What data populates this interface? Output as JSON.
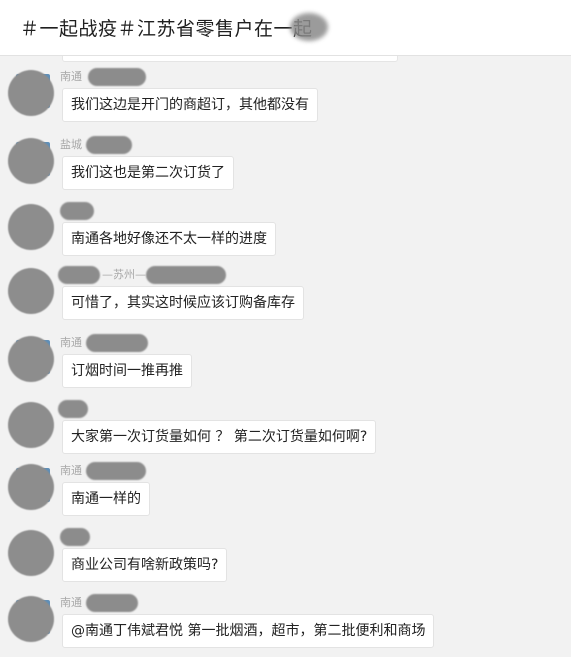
{
  "header": {
    "title": "＃一起战疫＃江苏省零售户在一起"
  },
  "messages": [
    {
      "sender": "南通",
      "text": "我们这边是开门的商超订，其他都没有"
    },
    {
      "sender": "盐城",
      "text": "我们这也是第二次订货了"
    },
    {
      "sender": "",
      "text": "南通各地好像还不太一样的进度"
    },
    {
      "sender": "—苏州—",
      "text": "可惜了，其实这时候应该订购备库存"
    },
    {
      "sender": "南通",
      "text": "订烟时间一推再推"
    },
    {
      "sender": "",
      "text": "大家第一次订货量如何 ？ 第二次订货量如何啊?"
    },
    {
      "sender": "南通",
      "text": "南通一样的"
    },
    {
      "sender": "",
      "text": "商业公司有啥新政策吗?"
    },
    {
      "sender": "南通",
      "text": "@南通丁伟斌君悦 第一批烟酒，超市，第二批便利和商场"
    }
  ],
  "colors": {
    "background": "#f2f2f2",
    "bubble": "#ffffff",
    "header": "#ffffff",
    "redaction": "#8c8c8c"
  }
}
